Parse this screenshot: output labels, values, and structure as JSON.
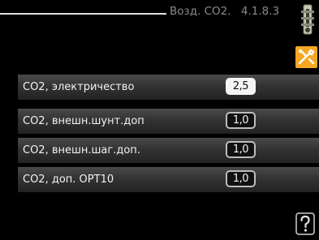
{
  "header": {
    "title": "Возд. CO2.",
    "menu_number": "4.1.8.3"
  },
  "icons": {
    "thermostat": "thermostat-icon",
    "tools": "tools-icon",
    "help": "help-icon"
  },
  "colors": {
    "tools_icon_bg": "#f5a623",
    "selected_value_bg": "#f4f4f4"
  },
  "rows": [
    {
      "label": "CO2, электричество",
      "value": "2,5",
      "selected": true
    },
    {
      "label": "CO2, внешн.шунт.доп",
      "value": "1,0",
      "selected": false
    },
    {
      "label": "CO2, внешн.шаг.доп.",
      "value": "1,0",
      "selected": false
    },
    {
      "label": "CO2, доп. OPT10",
      "value": "1,0",
      "selected": false
    }
  ]
}
